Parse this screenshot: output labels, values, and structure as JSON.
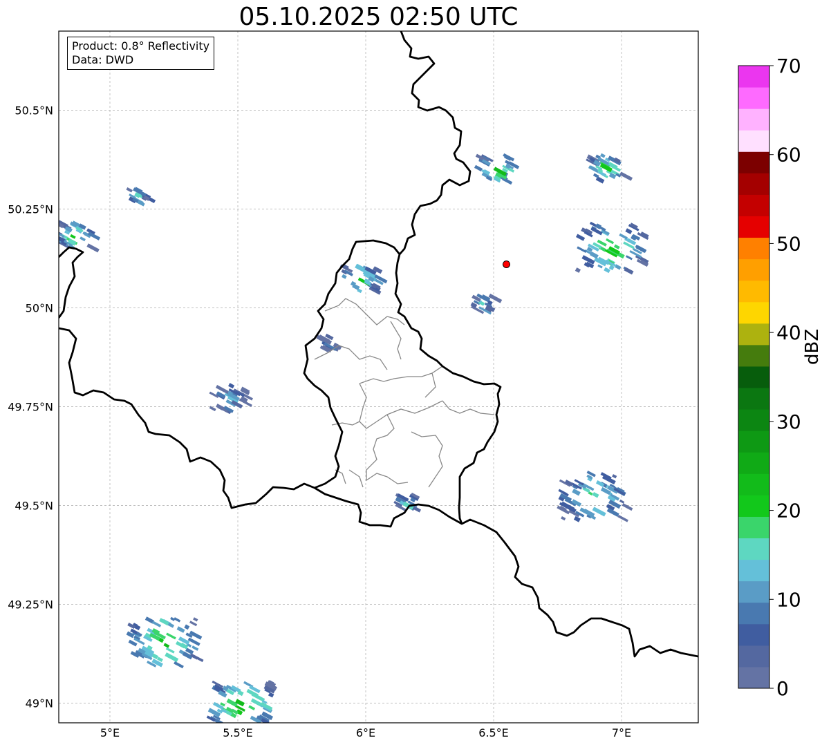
{
  "title": "05.10.2025 02:50 UTC",
  "info": {
    "product": "Product: 0.8° Reflectivity",
    "data": "Data: DWD"
  },
  "map": {
    "lon_range": [
      4.8,
      7.3
    ],
    "lat_range": [
      48.95,
      50.7
    ],
    "lon_ticks": [
      {
        "value": 5.0,
        "label": "5°E"
      },
      {
        "value": 5.5,
        "label": "5.5°E"
      },
      {
        "value": 6.0,
        "label": "6°E"
      },
      {
        "value": 6.5,
        "label": "6.5°E"
      },
      {
        "value": 7.0,
        "label": "7°E"
      }
    ],
    "lat_ticks": [
      {
        "value": 49.0,
        "label": "49°N"
      },
      {
        "value": 49.25,
        "label": "49.25°N"
      },
      {
        "value": 49.5,
        "label": "49.5°N"
      },
      {
        "value": 49.75,
        "label": "49.75°N"
      },
      {
        "value": 50.0,
        "label": "50°N"
      },
      {
        "value": 50.25,
        "label": "50.25°N"
      },
      {
        "value": 50.5,
        "label": "50.5°N"
      }
    ],
    "radar_site": {
      "lon": 6.55,
      "lat": 50.11,
      "color": "#ff0000"
    },
    "echoes": [
      {
        "lon": 4.85,
        "lat": 50.19,
        "dbz": 22,
        "size": "medium"
      },
      {
        "lon": 5.1,
        "lat": 50.29,
        "dbz": 18,
        "size": "small"
      },
      {
        "lon": 5.2,
        "lat": 49.16,
        "dbz": 24,
        "size": "large"
      },
      {
        "lon": 5.5,
        "lat": 49.0,
        "dbz": 24,
        "size": "large"
      },
      {
        "lon": 5.97,
        "lat": 50.08,
        "dbz": 22,
        "size": "medium"
      },
      {
        "lon": 6.5,
        "lat": 50.36,
        "dbz": 24,
        "size": "medium"
      },
      {
        "lon": 6.93,
        "lat": 50.36,
        "dbz": 22,
        "size": "medium"
      },
      {
        "lon": 6.95,
        "lat": 50.16,
        "dbz": 22,
        "size": "large"
      },
      {
        "lon": 6.88,
        "lat": 49.53,
        "dbz": 20,
        "size": "large"
      },
      {
        "lon": 6.45,
        "lat": 50.02,
        "dbz": 20,
        "size": "small"
      },
      {
        "lon": 6.15,
        "lat": 49.52,
        "dbz": 20,
        "size": "small"
      },
      {
        "lon": 5.45,
        "lat": 49.78,
        "dbz": 16,
        "size": "medium"
      },
      {
        "lon": 5.85,
        "lat": 49.92,
        "dbz": 14,
        "size": "small"
      }
    ]
  },
  "colorbar": {
    "label": "dBZ",
    "range": [
      0,
      70
    ],
    "tick_labels": [
      "0",
      "10",
      "20",
      "30",
      "40",
      "50",
      "60",
      "70"
    ],
    "colors": [
      "#6473a4",
      "#5468a0",
      "#405da0",
      "#4979b0",
      "#5a9cc6",
      "#64c0d9",
      "#5ed7c1",
      "#3ad56b",
      "#12c81b",
      "#12bb1a",
      "#10aa16",
      "#0e9914",
      "#0c8612",
      "#0b7711",
      "#075d0c",
      "#457c0d",
      "#adb20f",
      "#fed600",
      "#ffba00",
      "#ff9f00",
      "#ff8000",
      "#e50000",
      "#c40000",
      "#a40000",
      "#7c0000",
      "#ffe0ff",
      "#ffb2ff",
      "#fe6aff",
      "#eb36ef"
    ]
  }
}
